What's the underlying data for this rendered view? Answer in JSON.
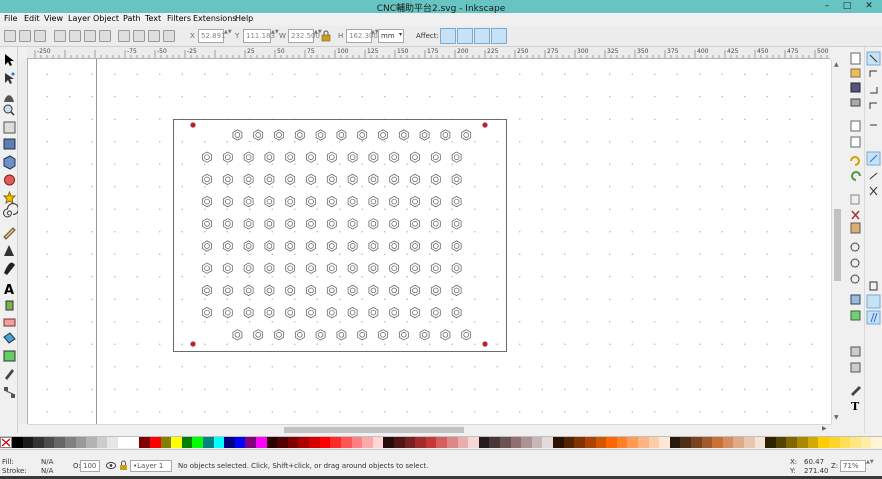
{
  "window": {
    "title": "CNC輔助平台2.svg - Inkscape",
    "minimize": "–",
    "maximize": "□",
    "close": "✕"
  },
  "menu": [
    "File",
    "Edit",
    "View",
    "Layer",
    "Object",
    "Path",
    "Text",
    "Filters",
    "Extensions",
    "Help"
  ],
  "toolbar": {
    "x_label": "X",
    "x_value": "52.891",
    "y_label": "Y",
    "y_value": "111.183",
    "w_label": "W",
    "w_value": "232.500",
    "h_label": "H",
    "h_value": "162.300",
    "unit": "mm",
    "affect_label": "Affect:"
  },
  "ruler_labels": [
    "-250",
    "",
    "",
    "-75",
    "-50",
    "-25",
    "",
    "25",
    "50",
    "75",
    "100",
    "125",
    "150",
    "175",
    "200",
    "225",
    "250",
    "275",
    "300",
    "325",
    "350",
    "375",
    "400",
    "425",
    "450",
    "475",
    "500"
  ],
  "colors": {
    "accent": "#68c4c2",
    "hole": "#c0202a",
    "page_border": "#6b6b6b"
  },
  "drawing": {
    "hole_color": "#c0202a",
    "hex_rows": 10,
    "hex_cols": 13
  },
  "palette": [
    "#000000",
    "#1a1a1a",
    "#333333",
    "#4d4d4d",
    "#666666",
    "#808080",
    "#999999",
    "#b3b3b3",
    "#cccccc",
    "#e6e6e6",
    "#ffffff",
    "#ffffff",
    "#800000",
    "#ff0000",
    "#808000",
    "#ffff00",
    "#008000",
    "#00ff00",
    "#008080",
    "#00ffff",
    "#000080",
    "#0000ff",
    "#800080",
    "#ff00ff",
    "#2b0000",
    "#550000",
    "#800000",
    "#aa0000",
    "#d40000",
    "#ff0000",
    "#ff2a2a",
    "#ff5555",
    "#ff8080",
    "#ffaaaa",
    "#ffd5d5",
    "#280b0b",
    "#501616",
    "#782121",
    "#a02c2c",
    "#c83737",
    "#d35f5f",
    "#de8787",
    "#e9afaf",
    "#f4d7d7",
    "#241c1c",
    "#483737",
    "#6c5353",
    "#916f6f",
    "#ac9393",
    "#c8b7b7",
    "#e3dbdb",
    "#2b1100",
    "#552200",
    "#803300",
    "#aa4400",
    "#d45500",
    "#ff6600",
    "#ff7f2a",
    "#ff9955",
    "#ffb380",
    "#ffccaa",
    "#ffe6d5",
    "#28170b",
    "#502d16",
    "#784421",
    "#a05a2c",
    "#c87137",
    "#d38d5f",
    "#deaa87",
    "#e9c6af",
    "#f4e3d7",
    "#2b2200",
    "#554400",
    "#806600",
    "#aa8800",
    "#d4aa00",
    "#ffcc00",
    "#ffd42a",
    "#ffdd55",
    "#ffe680",
    "#ffeeaa",
    "#fff6d5"
  ],
  "status": {
    "fill_label": "Fill:",
    "fill_value": "N/A",
    "stroke_label": "Stroke:",
    "stroke_value": "N/A",
    "opacity_label": "O:",
    "opacity_value": "100",
    "layer": "•Layer 1",
    "message": "No objects selected. Click, Shift+click, or drag around objects to select.",
    "x_label": "X:",
    "x_value": "60.47",
    "y_label": "Y:",
    "y_value": "271.40",
    "zoom_label": "Z:",
    "zoom_value": "71%"
  }
}
